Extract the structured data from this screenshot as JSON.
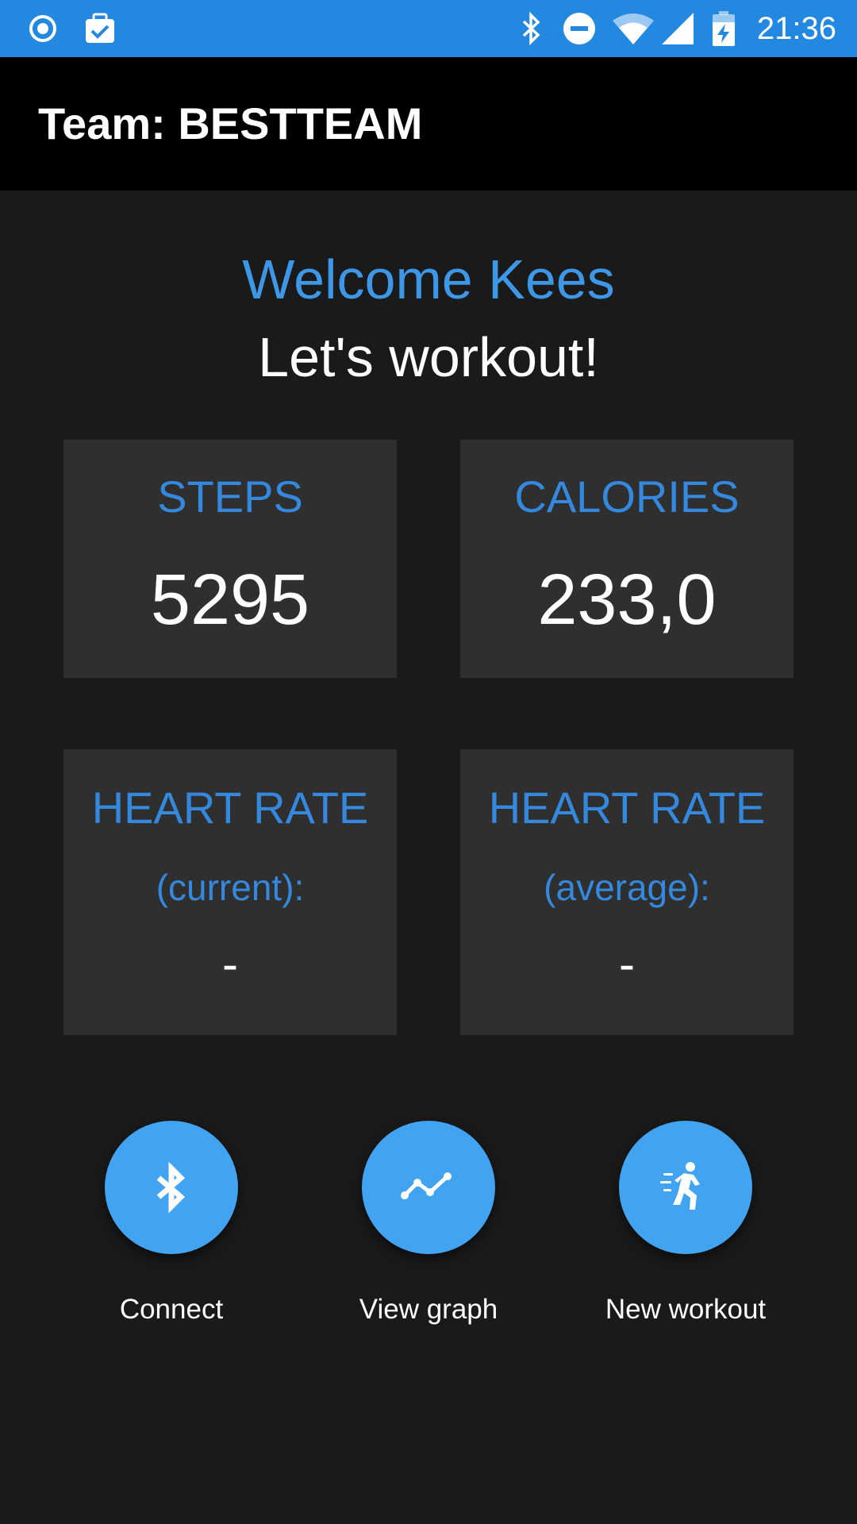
{
  "status_bar": {
    "time": "21:36",
    "icons": [
      "record-icon",
      "clipboard-check-icon",
      "bluetooth-icon",
      "do-not-disturb-icon",
      "wifi-icon",
      "signal-icon",
      "battery-charging-icon"
    ],
    "color": "#2388e0"
  },
  "app_bar": {
    "title": "Team: BESTTEAM"
  },
  "greeting": {
    "welcome": "Welcome Kees",
    "subtitle": "Let's workout!"
  },
  "stats": {
    "steps": {
      "label": "STEPS",
      "value": "5295"
    },
    "calories": {
      "label": "CALORIES",
      "value": "233,0"
    },
    "heart_current": {
      "label": "HEART RATE",
      "sub": "(current):",
      "value": "-"
    },
    "heart_average": {
      "label": "HEART RATE",
      "sub": "(average):",
      "value": "-"
    }
  },
  "actions": {
    "connect": {
      "label": "Connect",
      "icon": "bluetooth-icon"
    },
    "graph": {
      "label": "View graph",
      "icon": "line-graph-icon"
    },
    "workout": {
      "label": "New workout",
      "icon": "running-person-icon"
    }
  },
  "colors": {
    "accent": "#3d97e6",
    "button": "#42a3f0",
    "background": "#1a1a1a",
    "card": "#2f2f2f",
    "app_bar": "#000000"
  }
}
